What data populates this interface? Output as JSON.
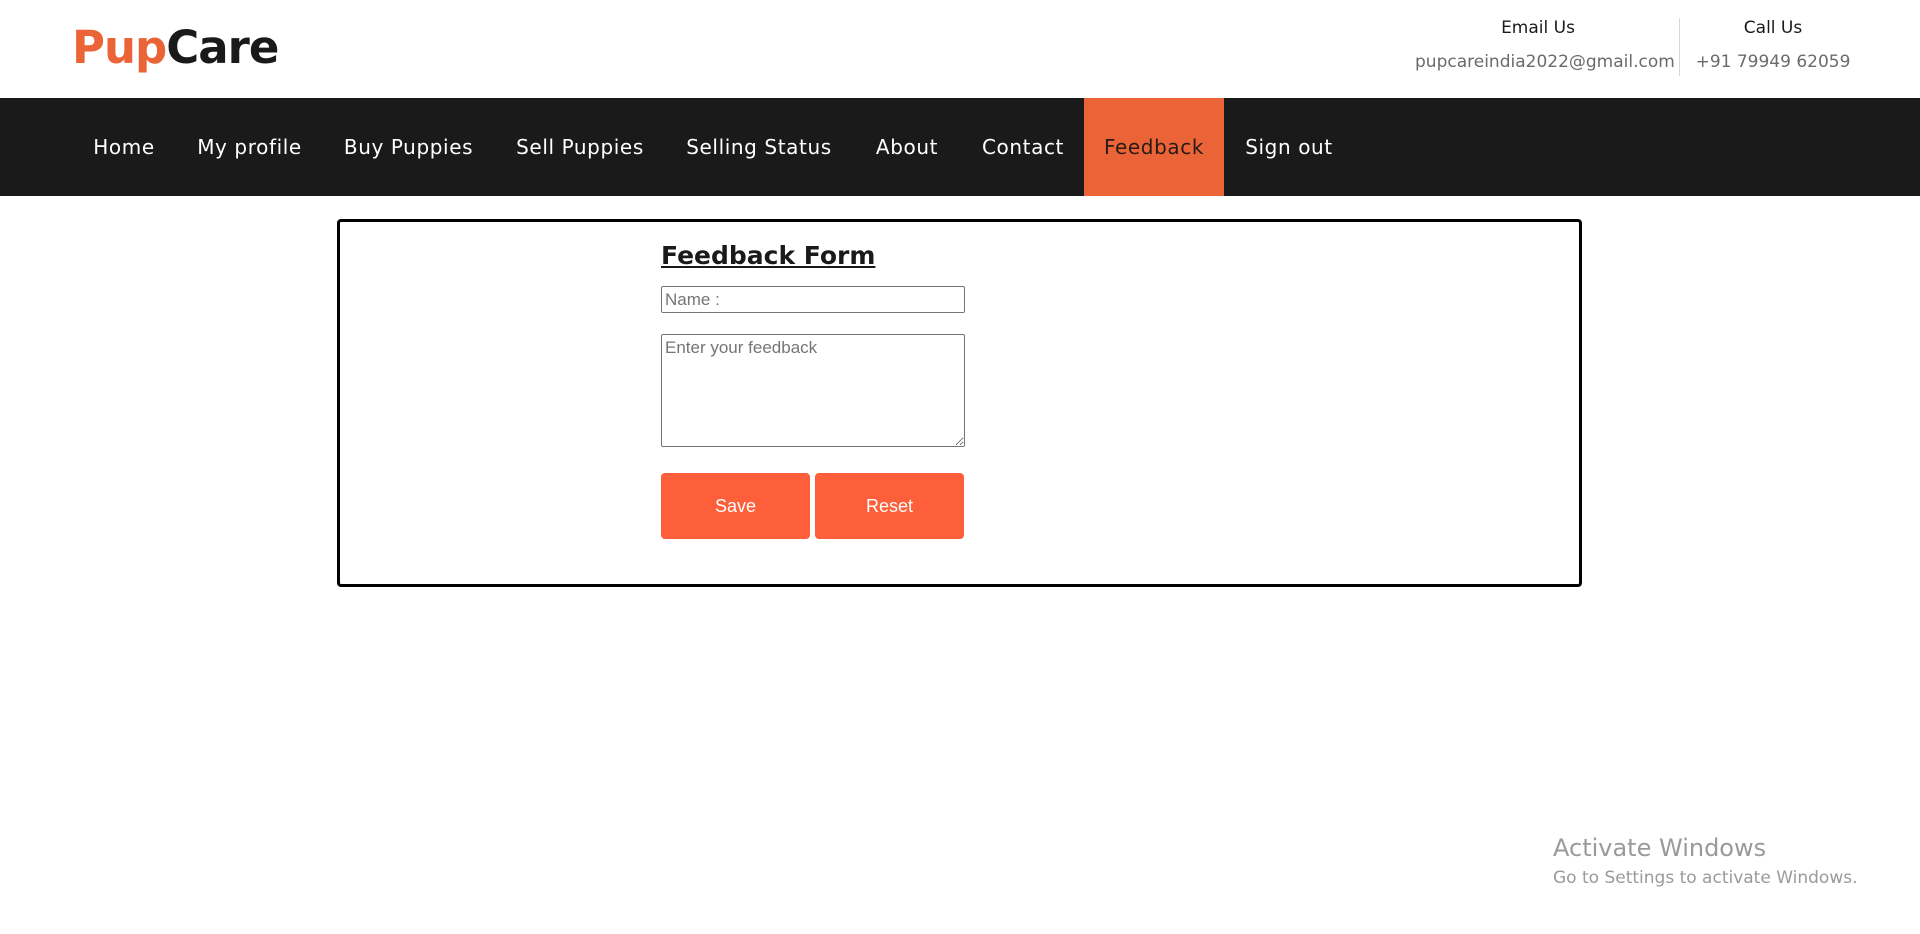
{
  "brand": {
    "part1": "Pup",
    "part2": "Care"
  },
  "contact": {
    "email_label": "Email Us",
    "email_value": "pupcareindia2022@gmail.com",
    "call_label": "Call Us",
    "call_value": "+91 79949 62059"
  },
  "nav": {
    "items": [
      {
        "label": "Home"
      },
      {
        "label": "My profile"
      },
      {
        "label": "Buy Puppies"
      },
      {
        "label": "Sell Puppies"
      },
      {
        "label": "Selling Status"
      },
      {
        "label": "About"
      },
      {
        "label": "Contact"
      },
      {
        "label": "Feedback",
        "active": true
      },
      {
        "label": "Sign out"
      }
    ]
  },
  "form": {
    "title": "Feedback Form",
    "name_placeholder": "Name :",
    "name_value": "",
    "feedback_placeholder": "Enter your feedback",
    "feedback_value": "",
    "save_label": "Save",
    "reset_label": "Reset"
  },
  "watermark": {
    "line1": "Activate Windows",
    "line2": "Go to Settings to activate Windows."
  },
  "colors": {
    "accent": "#ea6438",
    "button": "#fd5f3a",
    "navbar": "#1a1a1a"
  }
}
